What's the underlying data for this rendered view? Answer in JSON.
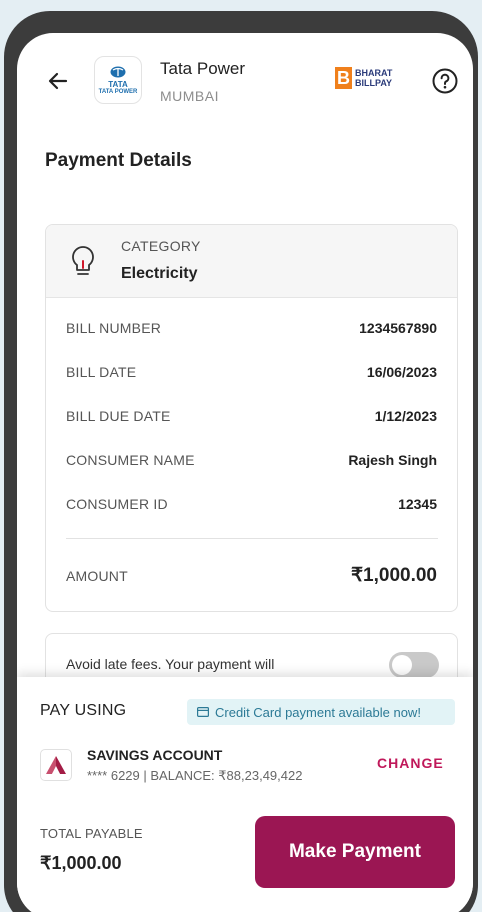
{
  "header": {
    "biller_name": "Tata Power",
    "biller_city": "MUMBAI",
    "biller_logo_line1": "TATA",
    "biller_logo_line2": "TATA POWER",
    "bbps_line1": "BHARAT",
    "bbps_line2": "BILLPAY"
  },
  "section_title": "Payment Details",
  "category": {
    "label": "CATEGORY",
    "value": "Electricity"
  },
  "details": [
    {
      "label": "BILL NUMBER",
      "value": "1234567890"
    },
    {
      "label": "BILL DATE",
      "value": "16/06/2023"
    },
    {
      "label": "BILL DUE DATE",
      "value": "1/12/2023"
    },
    {
      "label": "CONSUMER NAME",
      "value": "Rajesh Singh"
    },
    {
      "label": "CONSUMER ID",
      "value": "12345"
    }
  ],
  "amount": {
    "label": "AMOUNT",
    "value": "₹1,000.00"
  },
  "late_fee": {
    "text": "Avoid late fees. Your payment will",
    "toggle_on": false
  },
  "payment": {
    "pay_using_label": "PAY USING",
    "cc_badge": "Credit Card payment available now!",
    "account_name": "SAVINGS ACCOUNT",
    "account_detail": "**** 6229 | BALANCE: ₹88,23,49,422",
    "change_label": "CHANGE",
    "total_label": "TOTAL PAYABLE",
    "total_value": "₹1,000.00",
    "pay_button": "Make Payment"
  },
  "colors": {
    "primary": "#9b1653",
    "change_text": "#c0185a",
    "badge_bg": "#e2f3f6",
    "badge_text": "#2c7a96",
    "bbps_orange": "#f0801c",
    "bank_red": "#a31c45"
  }
}
